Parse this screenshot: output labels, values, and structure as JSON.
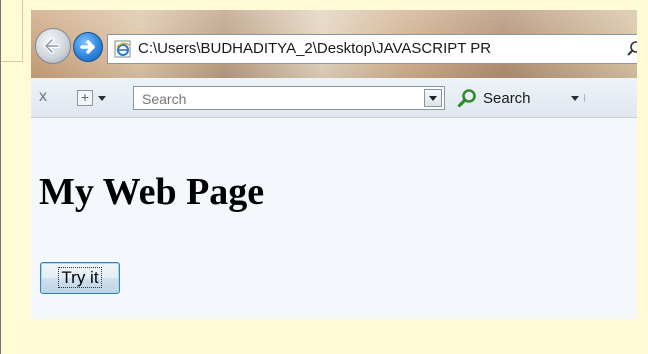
{
  "browser": {
    "address_url": "C:\\Users\\BUDHADITYA_2\\Desktop\\JAVASCRIPT PR",
    "search_placeholder": "Search",
    "search_button_label": "Search",
    "toolbar_close_label": "x",
    "toolbar_add_label": "+"
  },
  "page": {
    "heading": "My Web Page",
    "button_label": "Try it"
  },
  "colors": {
    "page_background": "#fffbd6",
    "content_background": "#f4f8fc",
    "forward_button": "#2f86df",
    "search_icon": "#2e8b2e"
  },
  "icons": {
    "back": "back-arrow-icon",
    "forward": "forward-arrow-icon",
    "page": "ie-page-icon",
    "address_search": "magnifier-icon",
    "search_go": "magnifier-icon"
  }
}
